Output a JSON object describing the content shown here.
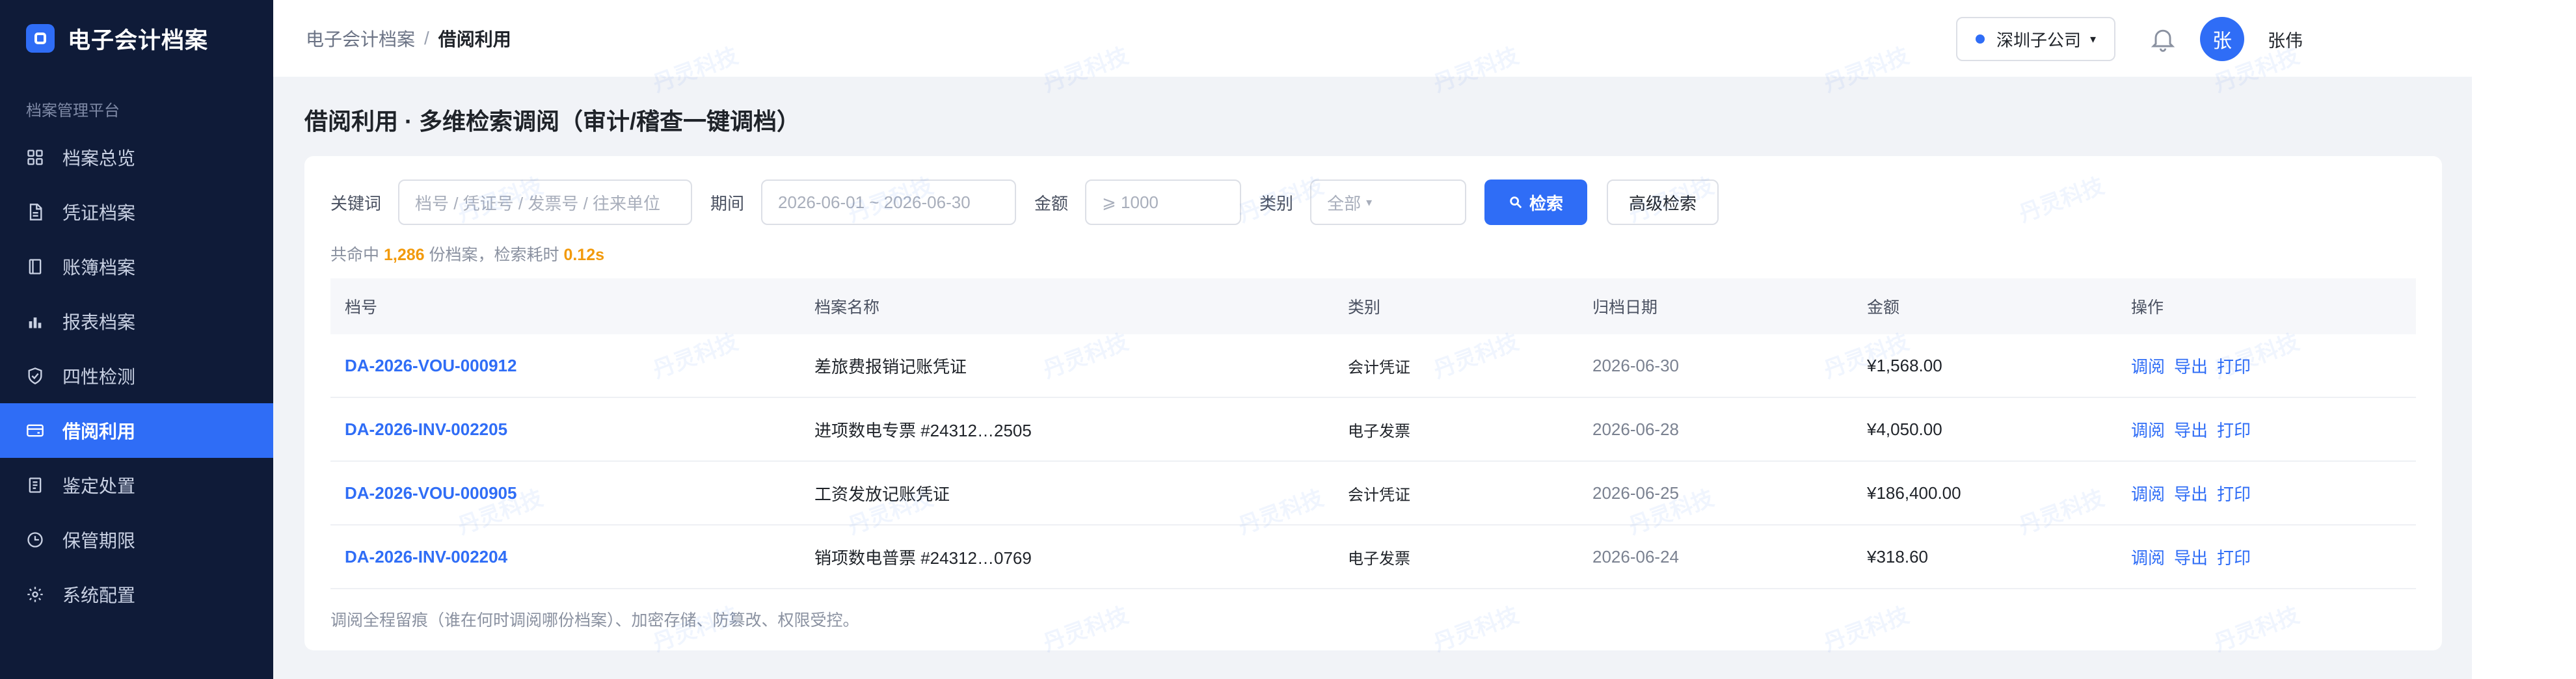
{
  "brand": {
    "title": "电子会计档案"
  },
  "sidebar": {
    "section_label": "档案管理平台",
    "items": [
      {
        "label": "档案总览",
        "icon": "grid-icon"
      },
      {
        "label": "凭证档案",
        "icon": "document-icon"
      },
      {
        "label": "账簿档案",
        "icon": "book-icon"
      },
      {
        "label": "报表档案",
        "icon": "bar-chart-icon"
      },
      {
        "label": "四性检测",
        "icon": "shield-check-icon"
      },
      {
        "label": "借阅利用",
        "icon": "card-icon",
        "active": true
      },
      {
        "label": "鉴定处置",
        "icon": "clipboard-icon"
      },
      {
        "label": "保管期限",
        "icon": "clock-icon"
      },
      {
        "label": "系统配置",
        "icon": "settings-icon"
      }
    ]
  },
  "topbar": {
    "breadcrumb": {
      "parent": "电子会计档案",
      "separator": "/",
      "current": "借阅利用"
    },
    "company": "深圳子公司",
    "avatar_initial": "张",
    "username": "张伟"
  },
  "page": {
    "title": "借阅利用 · 多维检索调阅（审计/稽查一键调档）"
  },
  "filters": {
    "keyword_label": "关键词",
    "keyword_placeholder": "档号 / 凭证号 / 发票号 / 往来单位",
    "period_label": "期间",
    "period_value": "2026-06-01 ~ 2026-06-30",
    "amount_label": "金额",
    "amount_placeholder": "⩾ 1000",
    "category_label": "类别",
    "category_value": "全部",
    "search_label": "检索",
    "advanced_label": "高级检索"
  },
  "summary": {
    "prefix": "共命中",
    "count": "1,286",
    "middle": "份档案，检索耗时",
    "time": "0.12s"
  },
  "table": {
    "headers": [
      "档号",
      "档案名称",
      "类别",
      "归档日期",
      "金额",
      "操作"
    ],
    "rows": [
      {
        "id": "DA-2026-VOU-000912",
        "name": "差旅费报销记账凭证",
        "category": "会计凭证",
        "date": "2026-06-30",
        "amount": "¥1,568.00"
      },
      {
        "id": "DA-2026-INV-002205",
        "name": "进项数电专票 #24312…2505",
        "category": "电子发票",
        "date": "2026-06-28",
        "amount": "¥4,050.00"
      },
      {
        "id": "DA-2026-VOU-000905",
        "name": "工资发放记账凭证",
        "category": "会计凭证",
        "date": "2026-06-25",
        "amount": "¥186,400.00"
      },
      {
        "id": "DA-2026-INV-002204",
        "name": "销项数电普票 #24312…0769",
        "category": "电子发票",
        "date": "2026-06-24",
        "amount": "¥318.60"
      }
    ],
    "actions": [
      "调阅",
      "导出",
      "打印"
    ]
  },
  "footnote": "调阅全程留痕（谁在何时调阅哪份档案）、加密存储、防篡改、权限受控。",
  "watermark": "丹灵科技",
  "colors": {
    "accent": "#2f6df6",
    "sidebar_bg": "#0f1b38",
    "highlight": "#f29a0c"
  }
}
